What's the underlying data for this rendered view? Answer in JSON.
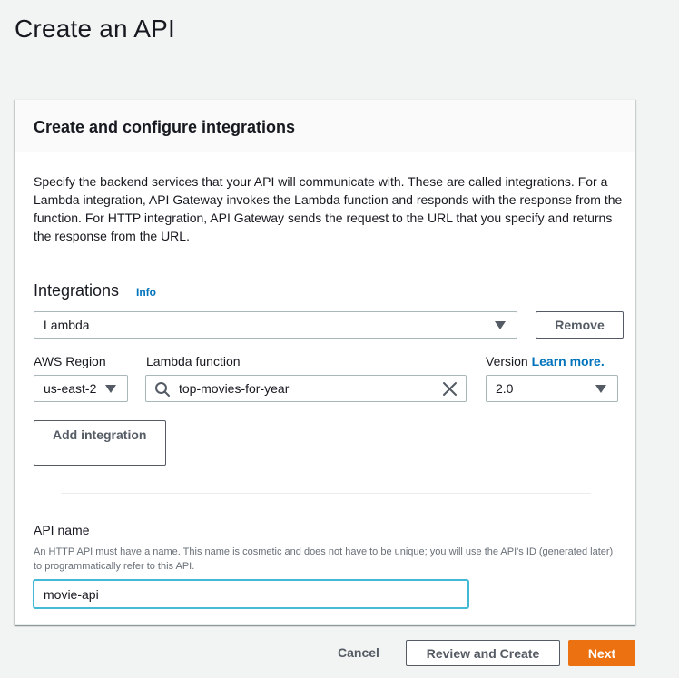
{
  "page": {
    "title": "Create an API"
  },
  "panel": {
    "title": "Create and configure integrations",
    "description": "Specify the backend services that your API will communicate with. These are called integrations. For a Lambda integration, API Gateway invokes the Lambda function and responds with the response from the function. For HTTP integration, API Gateway sends the request to the URL that you specify and returns the response from the URL."
  },
  "integrations": {
    "heading": "Integrations",
    "info_link": "Info",
    "type_value": "Lambda",
    "remove_label": "Remove",
    "region_label": "AWS Region",
    "region_value": "us-east-2",
    "function_label": "Lambda function",
    "function_value": "top-movies-for-year",
    "version_label": "Version",
    "version_link": "Learn more.",
    "version_value": "2.0",
    "add_label": "Add integration"
  },
  "api_name": {
    "label": "API name",
    "hint": "An HTTP API must have a name. This name is cosmetic and does not have to be unique; you will use the API's ID (generated later) to programmatically refer to this API.",
    "value": "movie-api"
  },
  "footer": {
    "cancel_label": "Cancel",
    "review_label": "Review and Create",
    "next_label": "Next"
  },
  "colors": {
    "accent": "#ec7211",
    "link": "#0073bb",
    "focus": "#44b9d6"
  }
}
